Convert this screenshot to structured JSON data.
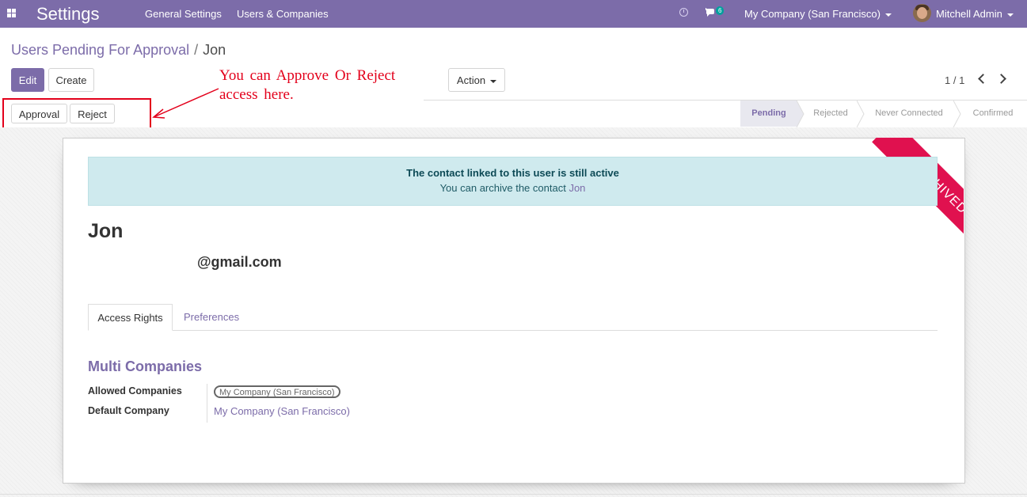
{
  "navbar": {
    "app_title": "Settings",
    "menu": [
      "General Settings",
      "Users & Companies"
    ],
    "chat_count": "6",
    "company": "My Company (San Francisco)",
    "user": "Mitchell Admin"
  },
  "breadcrumb": {
    "parent": "Users Pending For Approval",
    "separator": "/",
    "current": "Jon"
  },
  "toolbar": {
    "edit": "Edit",
    "create": "Create",
    "action": "Action"
  },
  "pager": "1 / 1",
  "annotation": "You can Approve Or Reject access here.",
  "header_buttons": {
    "approval": "Approval",
    "reject": "Reject"
  },
  "statusbar": {
    "stages": [
      "Pending",
      "Rejected",
      "Never Connected",
      "Confirmed"
    ],
    "active": "Pending"
  },
  "ribbon": "ARCHIVED",
  "alert": {
    "title": "The contact linked to this user is still active",
    "text": "You can archive the contact",
    "link": "Jon"
  },
  "record": {
    "name": "Jon",
    "email": "@gmail.com"
  },
  "tabs": [
    "Access Rights",
    "Preferences"
  ],
  "section": {
    "title": "Multi Companies",
    "allowed_label": "Allowed Companies",
    "allowed_value": "My Company (San Francisco)",
    "default_label": "Default Company",
    "default_value": "My Company (San Francisco)"
  },
  "colors": {
    "brand": "#7c6ca9",
    "ribbon": "#e0114f",
    "annotation": "#e3001b",
    "alert_bg": "#cfeaee"
  }
}
